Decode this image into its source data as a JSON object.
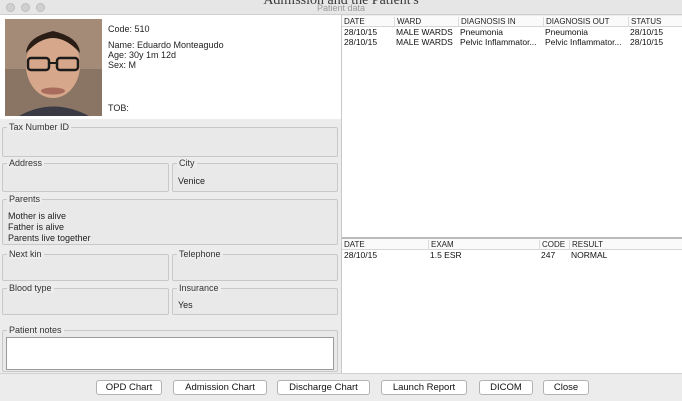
{
  "window": {
    "background_title": "Admission and the Patient's",
    "title": "Patient data"
  },
  "patient": {
    "code": "Code: 510",
    "name": "Name: Eduardo Monteagudo",
    "age": "Age: 30y 1m 12d",
    "sex": "Sex: M",
    "tob": "TOB:"
  },
  "fields": {
    "tax_label": "Tax Number ID",
    "tax_value": "",
    "address_label": "Address",
    "address_value": "",
    "city_label": "City",
    "city_value": "Venice",
    "parents_label": "Parents",
    "parents_lines": [
      "Mother is alive",
      "Father is alive",
      "Parents live together"
    ],
    "nextkin_label": "Next kin",
    "nextkin_value": "",
    "telephone_label": "Telephone",
    "telephone_value": "",
    "bloodtype_label": "Blood type",
    "bloodtype_value": "",
    "insurance_label": "Insurance",
    "insurance_value": "Yes",
    "notes_label": "Patient notes",
    "notes_value": ""
  },
  "admissions": {
    "headers": [
      "DATE",
      "WARD",
      "DIAGNOSIS IN",
      "DIAGNOSIS OUT",
      "STATUS"
    ],
    "rows": [
      [
        "28/10/15",
        "MALE WARDS",
        "Pneumonia",
        "Pneumonia",
        "28/10/15"
      ],
      [
        "28/10/15",
        "MALE WARDS",
        "Pelvic Inflammator...",
        "Pelvic Inflammator...",
        "28/10/15"
      ]
    ]
  },
  "exams": {
    "headers": [
      "DATE",
      "EXAM",
      "CODE",
      "RESULT"
    ],
    "rows": [
      [
        "28/10/15",
        "1.5 ESR",
        "247",
        "NORMAL"
      ]
    ]
  },
  "buttons": {
    "opd": "OPD Chart",
    "admission": "Admission Chart",
    "discharge": "Discharge Chart",
    "report": "Launch Report",
    "dicom": "DICOM",
    "close": "Close"
  },
  "icons": [
    "window-close-icon",
    "window-minimize-icon",
    "window-zoom-icon",
    "patient-photo"
  ]
}
